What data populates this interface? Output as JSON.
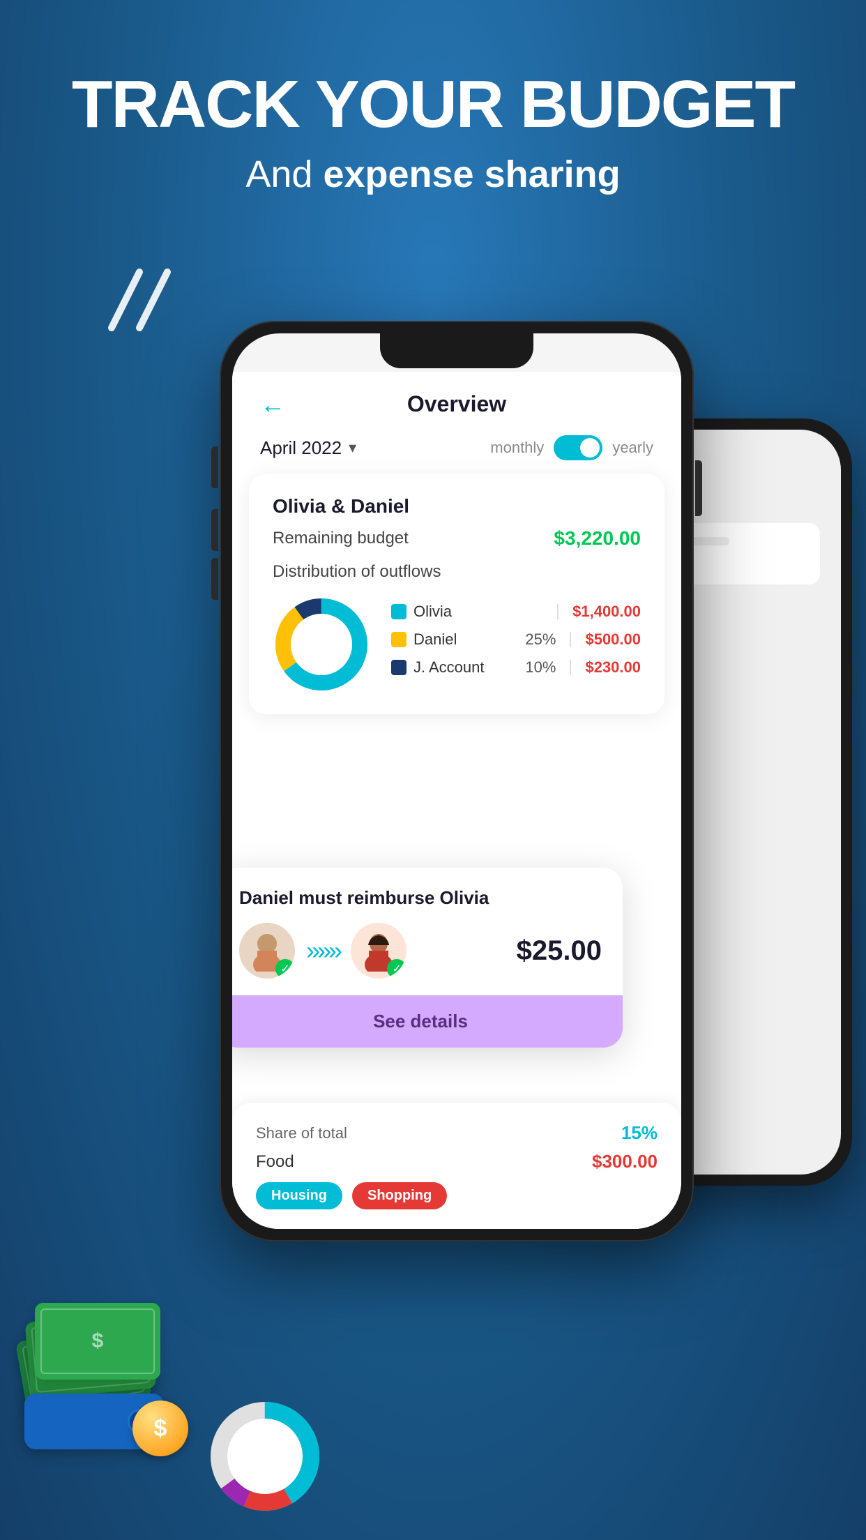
{
  "header": {
    "title": "TRACK YOUR BUDGET",
    "subtitle_plain": "And ",
    "subtitle_bold": "expense sharing"
  },
  "phone_main": {
    "nav": {
      "back_icon": "←",
      "title": "Overview"
    },
    "period": {
      "label": "April 2022",
      "arrow": "▾",
      "toggle_left": "monthly",
      "toggle_right": "yearly"
    },
    "budget_card": {
      "title": "Olivia & Daniel",
      "remaining_label": "Remaining budget",
      "remaining_amount": "$3,220.00",
      "distribution_label": "Distribution of outflows",
      "legend": [
        {
          "color": "#00bcd4",
          "name": "Olivia",
          "pct": "",
          "amount": "$1,400.00"
        },
        {
          "color": "#ffc107",
          "name": "Daniel",
          "pct": "25%",
          "amount": "$500.00"
        },
        {
          "color": "#1a3a6e",
          "name": "J. Account",
          "pct": "10%",
          "amount": "$230.00"
        }
      ]
    },
    "reimburse_card": {
      "title": "Daniel must reimburse Olivia",
      "amount": "$25.00",
      "see_details": "See details"
    },
    "bottom_card": {
      "share_label": "Share of total",
      "share_pct": "15%",
      "food_label": "Food",
      "food_amount": "$300.00",
      "tags": [
        "Housing",
        "Shopping"
      ]
    }
  },
  "colors": {
    "accent": "#00bcd4",
    "green": "#00c853",
    "red": "#e53935",
    "purple": "#d4aaff",
    "donut1": "#00bcd4",
    "donut2": "#ffc107",
    "donut3": "#1a3a6e"
  }
}
